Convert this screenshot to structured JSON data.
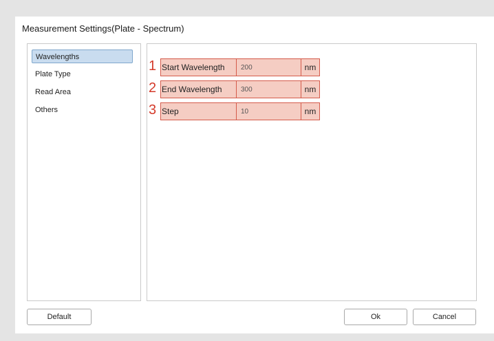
{
  "dialog": {
    "title": "Measurement Settings(Plate - Spectrum)"
  },
  "sidebar": {
    "items": [
      {
        "label": "Wavelengths",
        "selected": true
      },
      {
        "label": "Plate Type",
        "selected": false
      },
      {
        "label": "Read Area",
        "selected": false
      },
      {
        "label": "Others",
        "selected": false
      }
    ]
  },
  "settings": {
    "rows": [
      {
        "number": "1",
        "label": "Start Wavelength",
        "value": "200",
        "unit": "nm"
      },
      {
        "number": "2",
        "label": "End Wavelength",
        "value": "300",
        "unit": "nm"
      },
      {
        "number": "3",
        "label": "Step",
        "value": "10",
        "unit": "nm"
      }
    ]
  },
  "footer": {
    "default_label": "Default",
    "ok_label": "Ok",
    "cancel_label": "Cancel"
  },
  "colors": {
    "highlight_fill": "#f5cdc3",
    "highlight_border": "#d45a4a",
    "annotation_number": "#d43a2a",
    "selected_nav": "#c9dcef"
  }
}
